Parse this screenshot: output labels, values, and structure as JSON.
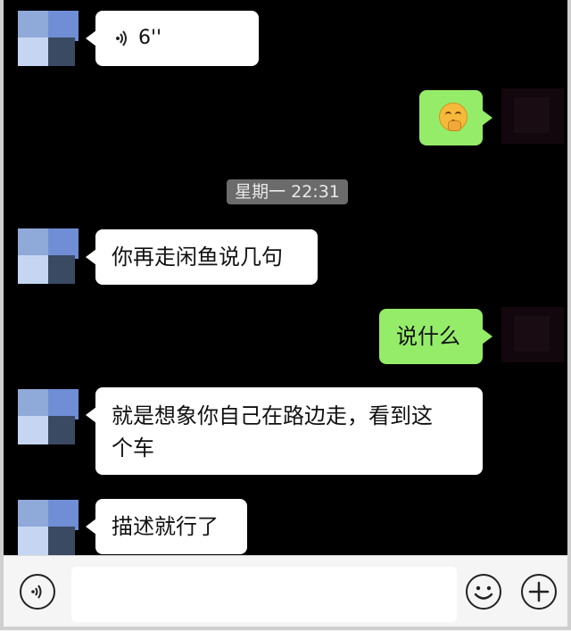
{
  "chat": {
    "messages": [
      {
        "side": "left",
        "type": "voice",
        "text": "6''"
      },
      {
        "side": "right",
        "type": "emoji",
        "icon": "shushing-face-emoji"
      },
      {
        "side": "left",
        "type": "text",
        "text": "你再走闲鱼说几句"
      },
      {
        "side": "right",
        "type": "text",
        "text": "说什么"
      },
      {
        "side": "left",
        "type": "text",
        "line1": "就是想象你自己在路边走，看到这",
        "line2": "个车"
      },
      {
        "side": "left",
        "type": "text",
        "text": "描述就行了"
      }
    ],
    "timestamp": "星期一 22:31"
  },
  "input_bar": {
    "voice_icon": "voice-toggle-icon",
    "emoji_icon": "emoji-icon",
    "plus_icon": "plus-icon",
    "text_value": ""
  },
  "colors": {
    "background": "#000000",
    "incoming_bubble": "#ffffff",
    "outgoing_bubble": "#95ec69",
    "timestamp_bg": "#6b6b6b"
  }
}
